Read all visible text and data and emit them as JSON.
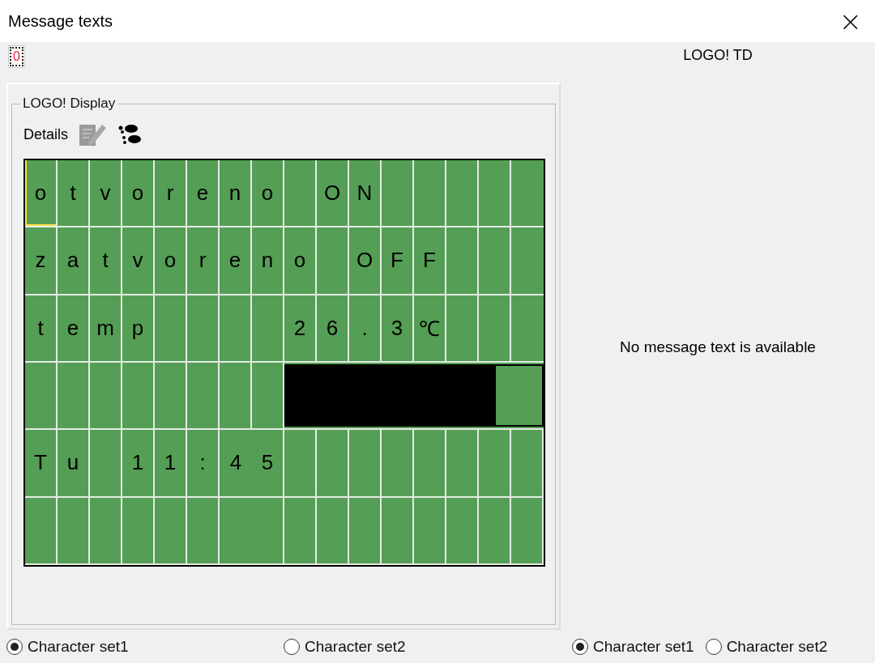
{
  "window": {
    "title": "Message texts",
    "close": "×"
  },
  "tabs": [
    {
      "label": "0",
      "selected": true
    }
  ],
  "display_group": {
    "title": "LOGO! Display",
    "details_label": "Details",
    "rows": [
      {
        "kind": "text",
        "cursor": true,
        "cells": [
          "o",
          "t",
          "v",
          "o",
          "r",
          "e",
          "n",
          "o",
          " ",
          "O",
          "N",
          " ",
          " ",
          " ",
          " ",
          " "
        ]
      },
      {
        "kind": "text",
        "cursor": false,
        "cells": [
          "z",
          "a",
          "t",
          "v",
          "o",
          "r",
          "e",
          "n",
          "o",
          " ",
          "O",
          "F",
          "F",
          " ",
          " ",
          " "
        ]
      },
      {
        "kind": "text",
        "cursor": false,
        "cells": [
          "t",
          "e",
          "m",
          "p",
          " ",
          " ",
          " ",
          " ",
          "2",
          "6",
          ".",
          "3",
          "℃",
          " ",
          " ",
          " "
        ]
      },
      {
        "kind": "bar",
        "cursor": false,
        "level": 0.82,
        "cells": [
          " ",
          " ",
          " ",
          " ",
          " ",
          " ",
          " ",
          " "
        ]
      },
      {
        "kind": "text",
        "cursor": false,
        "cells": [
          "T",
          "u",
          " ",
          "1",
          "1",
          ":",
          "4",
          "5",
          " ",
          " ",
          " ",
          " ",
          " ",
          " ",
          " ",
          " "
        ]
      },
      {
        "kind": "text",
        "cursor": false,
        "cells": [
          " ",
          " ",
          " ",
          " ",
          " ",
          " ",
          " ",
          " ",
          " ",
          " ",
          " ",
          " ",
          " ",
          " ",
          " ",
          " "
        ]
      }
    ]
  },
  "left_charsets": [
    {
      "label": "Character set1",
      "selected": true
    },
    {
      "label": "Character set2",
      "selected": false
    }
  ],
  "td_panel": {
    "title": "LOGO! TD",
    "message": "No message text is available"
  },
  "right_charsets": [
    {
      "label": "Character set1",
      "selected": true
    },
    {
      "label": "Character set2",
      "selected": false
    }
  ]
}
